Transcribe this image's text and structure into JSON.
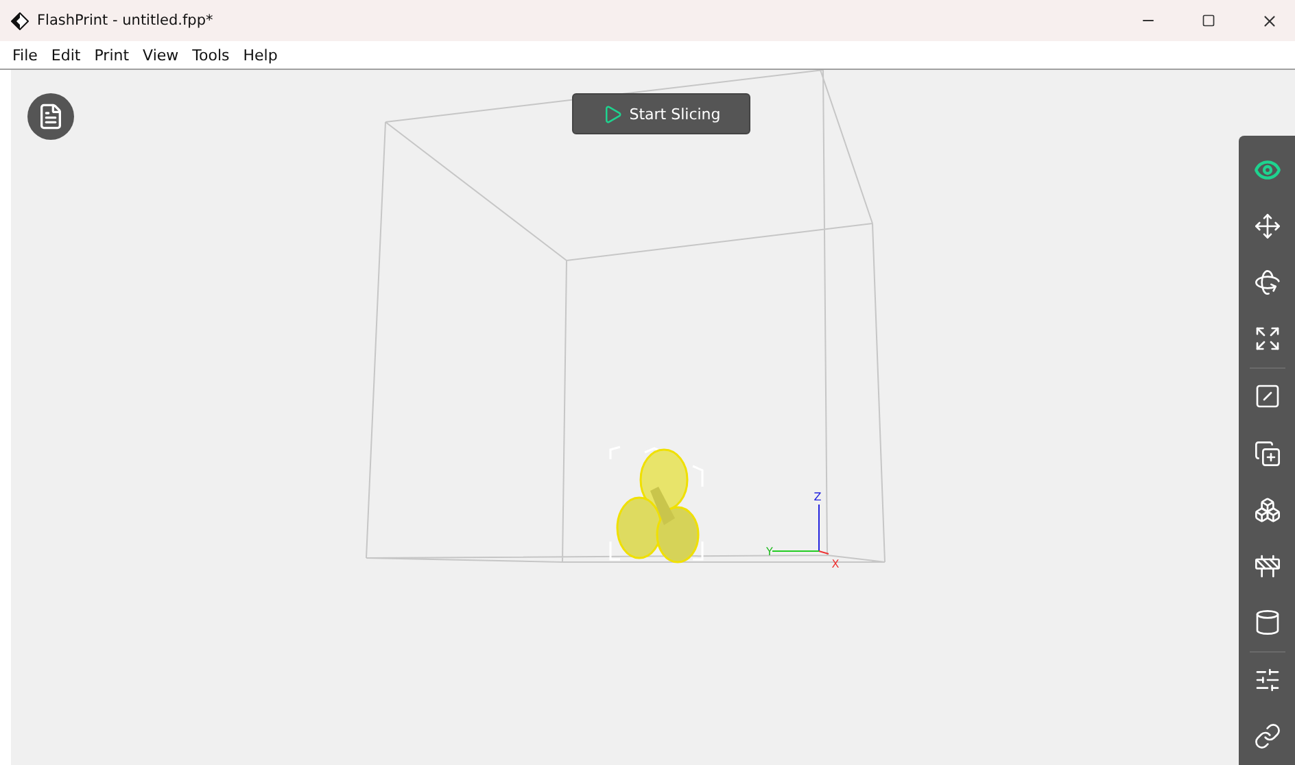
{
  "window": {
    "title": "FlashPrint - untitled.fpp*"
  },
  "menu": [
    "File",
    "Edit",
    "Print",
    "View",
    "Tools",
    "Help"
  ],
  "slice_button": {
    "label": "Start Slicing"
  },
  "axes": [
    {
      "kind": "z",
      "label": "Z"
    },
    {
      "kind": "y",
      "label": "Y"
    },
    {
      "kind": "x",
      "label": "X"
    }
  ],
  "tools": [
    {
      "kind": "view",
      "selected": true
    },
    {
      "kind": "move",
      "selected": false
    },
    {
      "kind": "rotate",
      "selected": false
    },
    {
      "kind": "scale",
      "selected": false,
      "divider": true
    },
    {
      "kind": "cut",
      "selected": false
    },
    {
      "kind": "add",
      "selected": false
    },
    {
      "kind": "models",
      "selected": false
    },
    {
      "kind": "supports",
      "selected": false
    },
    {
      "kind": "extruder",
      "selected": false,
      "divider": true
    },
    {
      "kind": "settings",
      "selected": false
    },
    {
      "kind": "link",
      "selected": false
    }
  ]
}
